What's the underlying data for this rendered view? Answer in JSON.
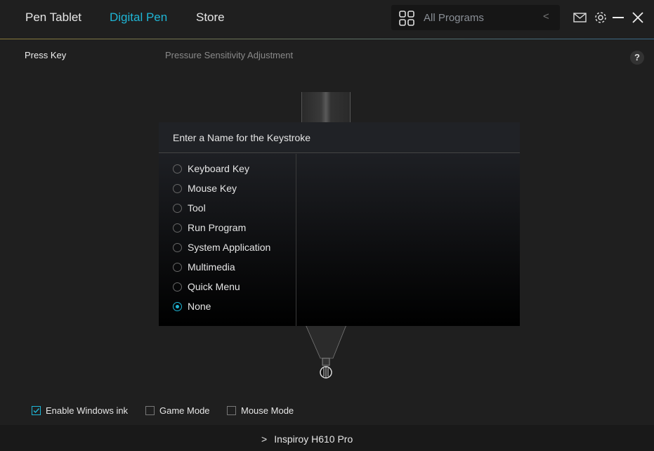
{
  "nav": {
    "tabs": [
      {
        "label": "Pen Tablet"
      },
      {
        "label": "Digital Pen"
      },
      {
        "label": "Store"
      }
    ],
    "active": "Digital Pen",
    "accent": "#1fb6d6"
  },
  "programs": {
    "label": "All Programs"
  },
  "subnav": {
    "press_key": "Press Key",
    "pressure": "Pressure Sensitivity Adjustment",
    "help": "?"
  },
  "dialog": {
    "title": "Enter a Name for the Keystroke",
    "options": [
      "Keyboard Key",
      "Mouse Key",
      "Tool",
      "Run Program",
      "System Application",
      "Multimedia",
      "Quick Menu",
      "None"
    ],
    "selected": "None"
  },
  "checks": [
    {
      "label": "Enable Windows ink",
      "checked": true
    },
    {
      "label": "Game Mode",
      "checked": false
    },
    {
      "label": "Mouse Mode",
      "checked": false
    }
  ],
  "device": {
    "name": "Inspiroy H610 Pro"
  }
}
